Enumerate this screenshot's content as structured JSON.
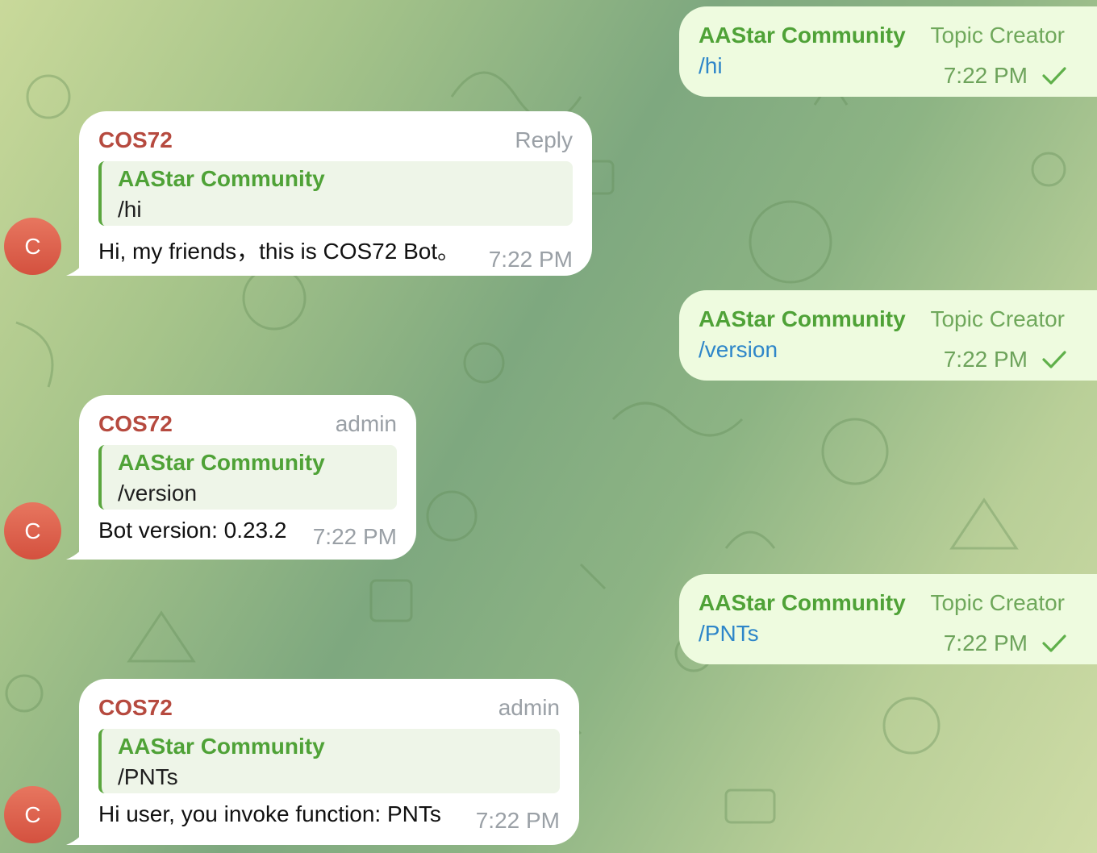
{
  "messages": [
    {
      "outgoing": {
        "sender": "AAStar Community",
        "role": "Topic Creator",
        "text": "/hi",
        "time": "7:22 PM"
      },
      "reply": {
        "sender": "COS72",
        "role": "Reply",
        "quote_sender": "AAStar Community",
        "quote_text": "/hi",
        "text": "Hi, my friends，this is COS72 Bot。",
        "time": "7:22 PM",
        "avatar": "C"
      }
    },
    {
      "outgoing": {
        "sender": "AAStar Community",
        "role": "Topic Creator",
        "text": "/version",
        "time": "7:22 PM"
      },
      "reply": {
        "sender": "COS72",
        "role": "admin",
        "quote_sender": "AAStar Community",
        "quote_text": "/version",
        "text": "Bot version: 0.23.2",
        "time": "7:22 PM",
        "avatar": "C"
      }
    },
    {
      "outgoing": {
        "sender": "AAStar Community",
        "role": "Topic Creator",
        "text": "/PNTs",
        "time": "7:22 PM"
      },
      "reply": {
        "sender": "COS72",
        "role": "admin",
        "quote_sender": "AAStar Community",
        "quote_text": "/PNTs",
        "text": "Hi user, you invoke function: PNTs",
        "time": "7:22 PM",
        "avatar": "C"
      }
    }
  ],
  "colors": {
    "outgoing_bubble": "#eefbdf",
    "incoming_bubble": "#ffffff",
    "sender_green": "#4fa237",
    "bot_name_red": "#b64a3f",
    "command_blue": "#2e86c9",
    "avatar": "#d9594a"
  },
  "icons": {
    "sent_status": "checkmark-icon"
  }
}
